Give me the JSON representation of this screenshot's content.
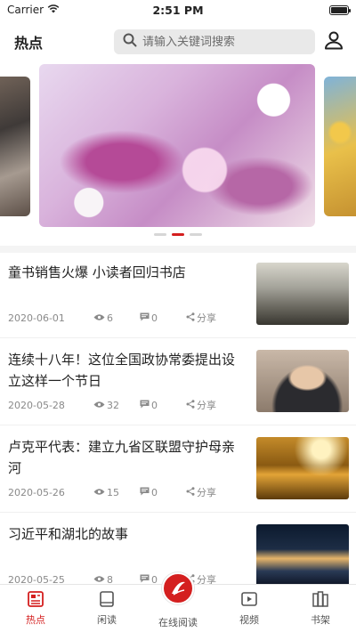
{
  "status_bar": {
    "carrier": "Carrier",
    "time": "2:51 PM"
  },
  "header": {
    "title": "热点",
    "search_placeholder": "请输入关键词搜索"
  },
  "news": [
    {
      "title": "童书销售火爆 小读者回归书店",
      "date": "2020-06-01",
      "views": "6",
      "comments": "0",
      "share": "分享"
    },
    {
      "title": "连续十八年！这位全国政协常委提出设立这样一个节日",
      "date": "2020-05-28",
      "views": "32",
      "comments": "0",
      "share": "分享"
    },
    {
      "title": "卢克平代表：建立九省区联盟守护母亲河",
      "date": "2020-05-26",
      "views": "15",
      "comments": "0",
      "share": "分享"
    },
    {
      "title": "习近平和湖北的故事",
      "date": "2020-05-25",
      "views": "8",
      "comments": "0",
      "share": "分享"
    }
  ],
  "tabbar": {
    "hot": "热点",
    "read": "闲读",
    "online": "在线阅读",
    "video": "视频",
    "shelf": "书架"
  },
  "colors": {
    "accent": "#d41f1f"
  },
  "carousel": {
    "slide_count": 3,
    "active_index": 1
  }
}
